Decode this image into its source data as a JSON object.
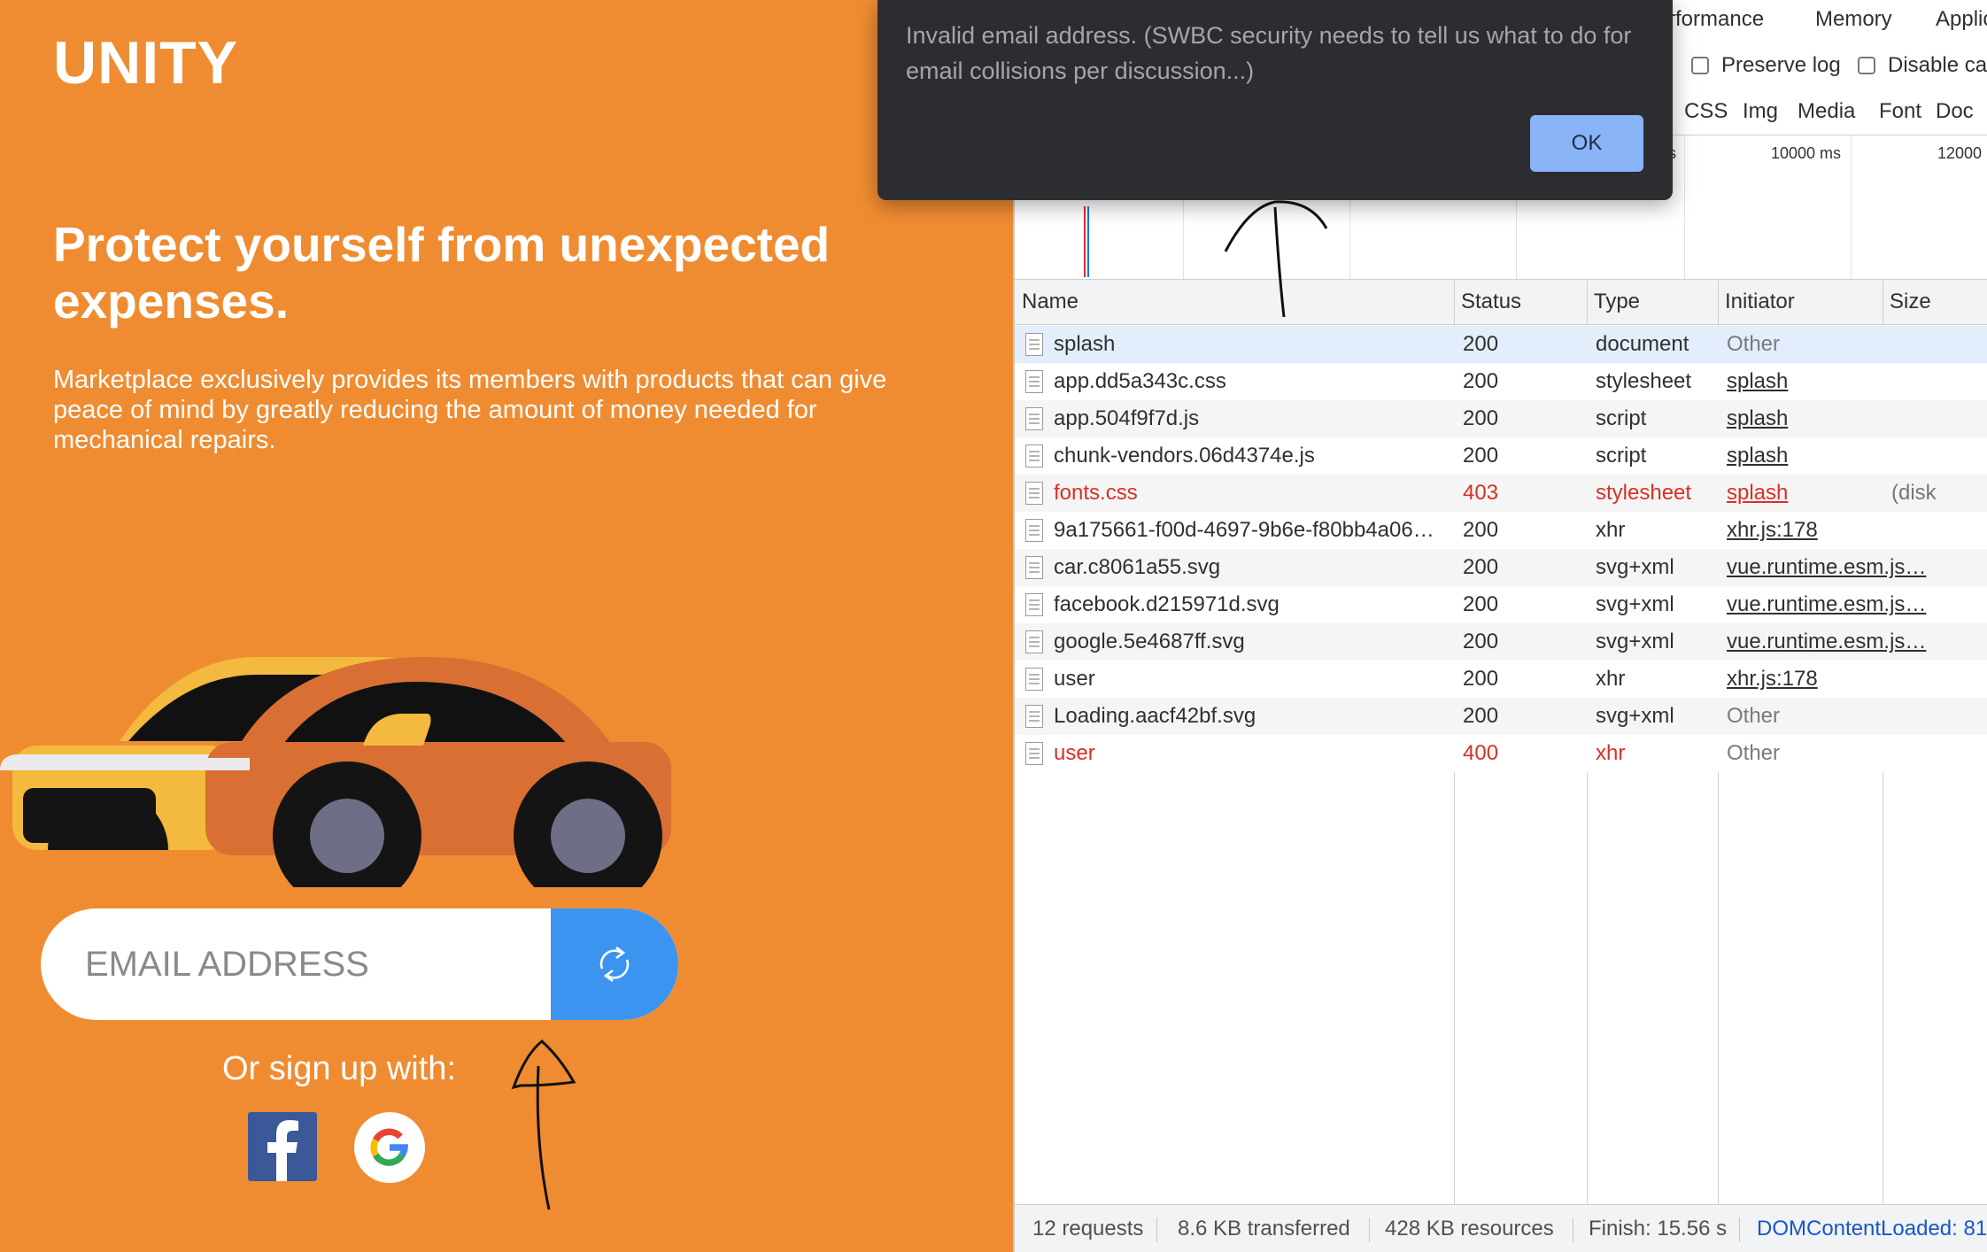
{
  "app": {
    "logo": "UNITY",
    "headline": "Protect yourself from unexpected expenses.",
    "subtext": "Marketplace exclusively provides its members with products that can give peace of mind by greatly reducing the amount of money needed for mechanical repairs.",
    "email_placeholder": "EMAIL ADDRESS",
    "signup_label": "Or sign up with:",
    "submit_icon": "refresh-loading-icon",
    "social": [
      "facebook",
      "google"
    ],
    "colors": {
      "background": "#ef8c32",
      "button": "#3b94f0"
    }
  },
  "alert": {
    "message": "Invalid email address. (SWBC security needs to tell us what to do for email collisions per discussion...)",
    "ok_label": "OK"
  },
  "devtools": {
    "tabs": [
      "rformance",
      "Memory",
      "Applic"
    ],
    "checkboxes": [
      "Preserve log",
      "Disable ca"
    ],
    "filters": [
      "CSS",
      "Img",
      "Media",
      "Font",
      "Doc"
    ],
    "timeline_labels": [
      "s",
      "10000 ms",
      "12000"
    ],
    "columns": [
      "Name",
      "Status",
      "Type",
      "Initiator",
      "Size"
    ],
    "rows": [
      {
        "name": "splash",
        "status": "200",
        "type": "document",
        "initiator": "Other",
        "size": ""
      },
      {
        "name": "app.dd5a343c.css",
        "status": "200",
        "type": "stylesheet",
        "initiator": "splash",
        "size": ""
      },
      {
        "name": "app.504f9f7d.js",
        "status": "200",
        "type": "script",
        "initiator": "splash",
        "size": ""
      },
      {
        "name": "chunk-vendors.06d4374e.js",
        "status": "200",
        "type": "script",
        "initiator": "splash",
        "size": ""
      },
      {
        "name": "fonts.css",
        "status": "403",
        "type": "stylesheet",
        "initiator": "splash",
        "size": "(disk"
      },
      {
        "name": "9a175661-f00d-4697-9b6e-f80bb4a06…",
        "status": "200",
        "type": "xhr",
        "initiator": "xhr.js:178",
        "size": ""
      },
      {
        "name": "car.c8061a55.svg",
        "status": "200",
        "type": "svg+xml",
        "initiator": "vue.runtime.esm.js…",
        "size": ""
      },
      {
        "name": "facebook.d215971d.svg",
        "status": "200",
        "type": "svg+xml",
        "initiator": "vue.runtime.esm.js…",
        "size": ""
      },
      {
        "name": "google.5e4687ff.svg",
        "status": "200",
        "type": "svg+xml",
        "initiator": "vue.runtime.esm.js…",
        "size": ""
      },
      {
        "name": "user",
        "status": "200",
        "type": "xhr",
        "initiator": "xhr.js:178",
        "size": ""
      },
      {
        "name": "Loading.aacf42bf.svg",
        "status": "200",
        "type": "svg+xml",
        "initiator": "Other",
        "size": ""
      },
      {
        "name": "user",
        "status": "400",
        "type": "xhr",
        "initiator": "Other",
        "size": ""
      }
    ],
    "status_bar": {
      "requests": "12 requests",
      "transferred": "8.6 KB transferred",
      "resources": "428 KB resources",
      "finish": "Finish: 15.56 s",
      "dom_content_loaded": "DOMContentLoaded: 81"
    }
  }
}
